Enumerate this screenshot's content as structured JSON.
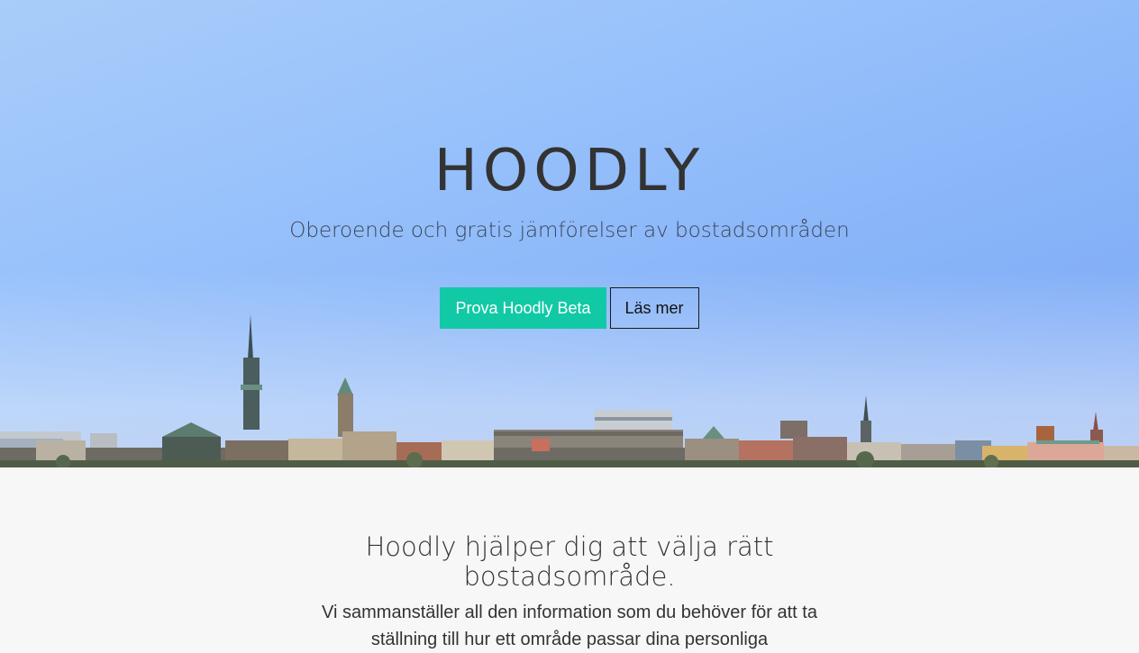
{
  "hero": {
    "title": "HOODLY",
    "subtitle": "Oberoende och gratis jämförelser av bostadsområden",
    "primary_button": "Prova Hoodly Beta",
    "secondary_button": "Läs mer"
  },
  "intro": {
    "heading": "Hoodly hjälper dig att välja rätt bostadsområde.",
    "body": "Vi sammanställer all den information som du behöver för att ta ställning till hur ett område passar dina personliga"
  },
  "colors": {
    "accent": "#12c9a6",
    "text_dark": "#333333",
    "section_bg": "#f7f7f7"
  }
}
